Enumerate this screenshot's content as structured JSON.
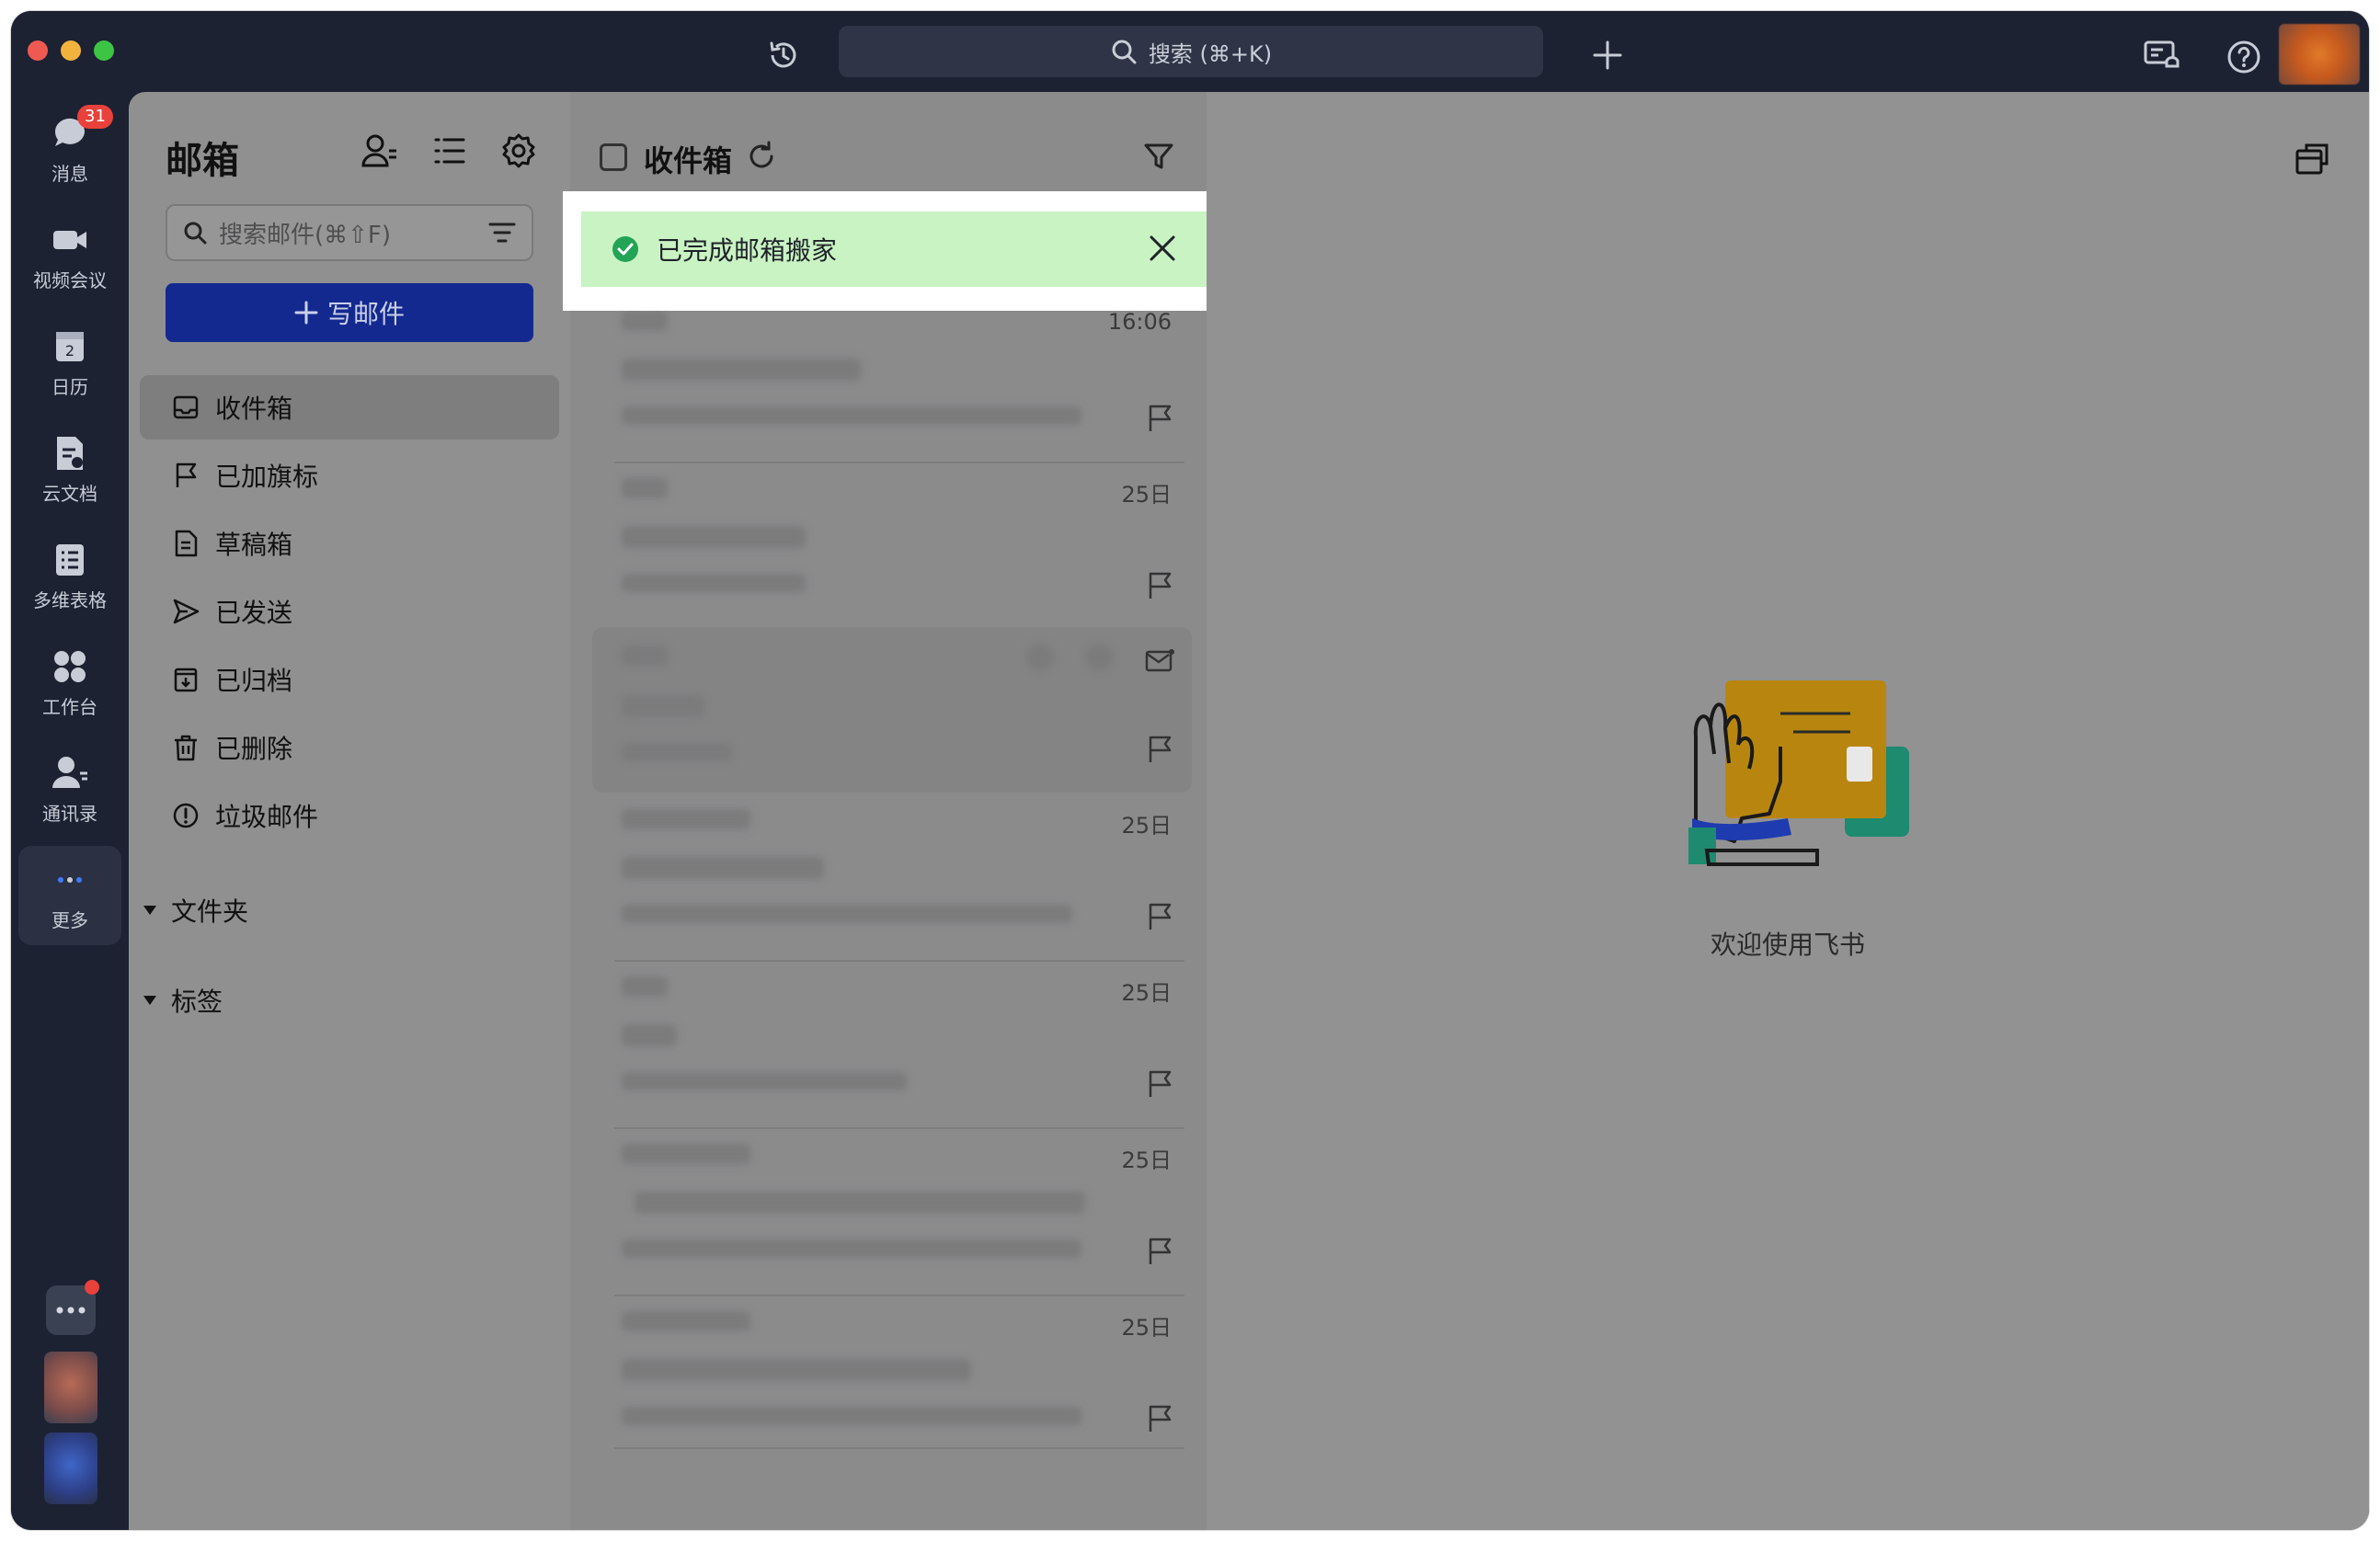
{
  "titlebar": {
    "search_placeholder": "搜索 (⌘+K)"
  },
  "leftnav": {
    "items": [
      {
        "label": "消息",
        "icon": "chat-bubble-icon",
        "badge": "31"
      },
      {
        "label": "视频会议",
        "icon": "video-camera-icon"
      },
      {
        "label": "日历",
        "icon": "calendar-icon",
        "day": "2"
      },
      {
        "label": "云文档",
        "icon": "cloud-doc-icon"
      },
      {
        "label": "多维表格",
        "icon": "bitable-icon"
      },
      {
        "label": "工作台",
        "icon": "workplace-icon"
      },
      {
        "label": "通讯录",
        "icon": "contacts-icon"
      },
      {
        "label": "更多",
        "icon": "more-dots-icon"
      }
    ]
  },
  "mail_sidebar": {
    "title": "邮箱",
    "search_placeholder": "搜索邮件(⌘⇧F)",
    "compose_label": "写邮件",
    "folders": [
      {
        "label": "收件箱",
        "icon": "inbox-icon"
      },
      {
        "label": "已加旗标",
        "icon": "flag-icon"
      },
      {
        "label": "草稿箱",
        "icon": "draft-icon"
      },
      {
        "label": "已发送",
        "icon": "send-icon"
      },
      {
        "label": "已归档",
        "icon": "archive-icon"
      },
      {
        "label": "已删除",
        "icon": "trash-icon"
      },
      {
        "label": "垃圾邮件",
        "icon": "spam-icon"
      }
    ],
    "groups": [
      {
        "label": "文件夹"
      },
      {
        "label": "标签"
      }
    ]
  },
  "mail_list": {
    "title": "收件箱",
    "toast": "已完成邮箱搬家",
    "items": [
      {
        "time": "16:06"
      },
      {
        "time": "25日"
      },
      {
        "time": ""
      },
      {
        "time": "25日"
      },
      {
        "time": "25日"
      },
      {
        "time": "25日"
      },
      {
        "time": "25日"
      }
    ]
  },
  "reader": {
    "welcome_text": "欢迎使用飞书"
  },
  "colors": {
    "nav_bg": "#1c2232",
    "compose_button": "#14298f",
    "toast_bg": "#c9f3c3",
    "toast_check": "#22a355",
    "badge": "#e8413b"
  }
}
